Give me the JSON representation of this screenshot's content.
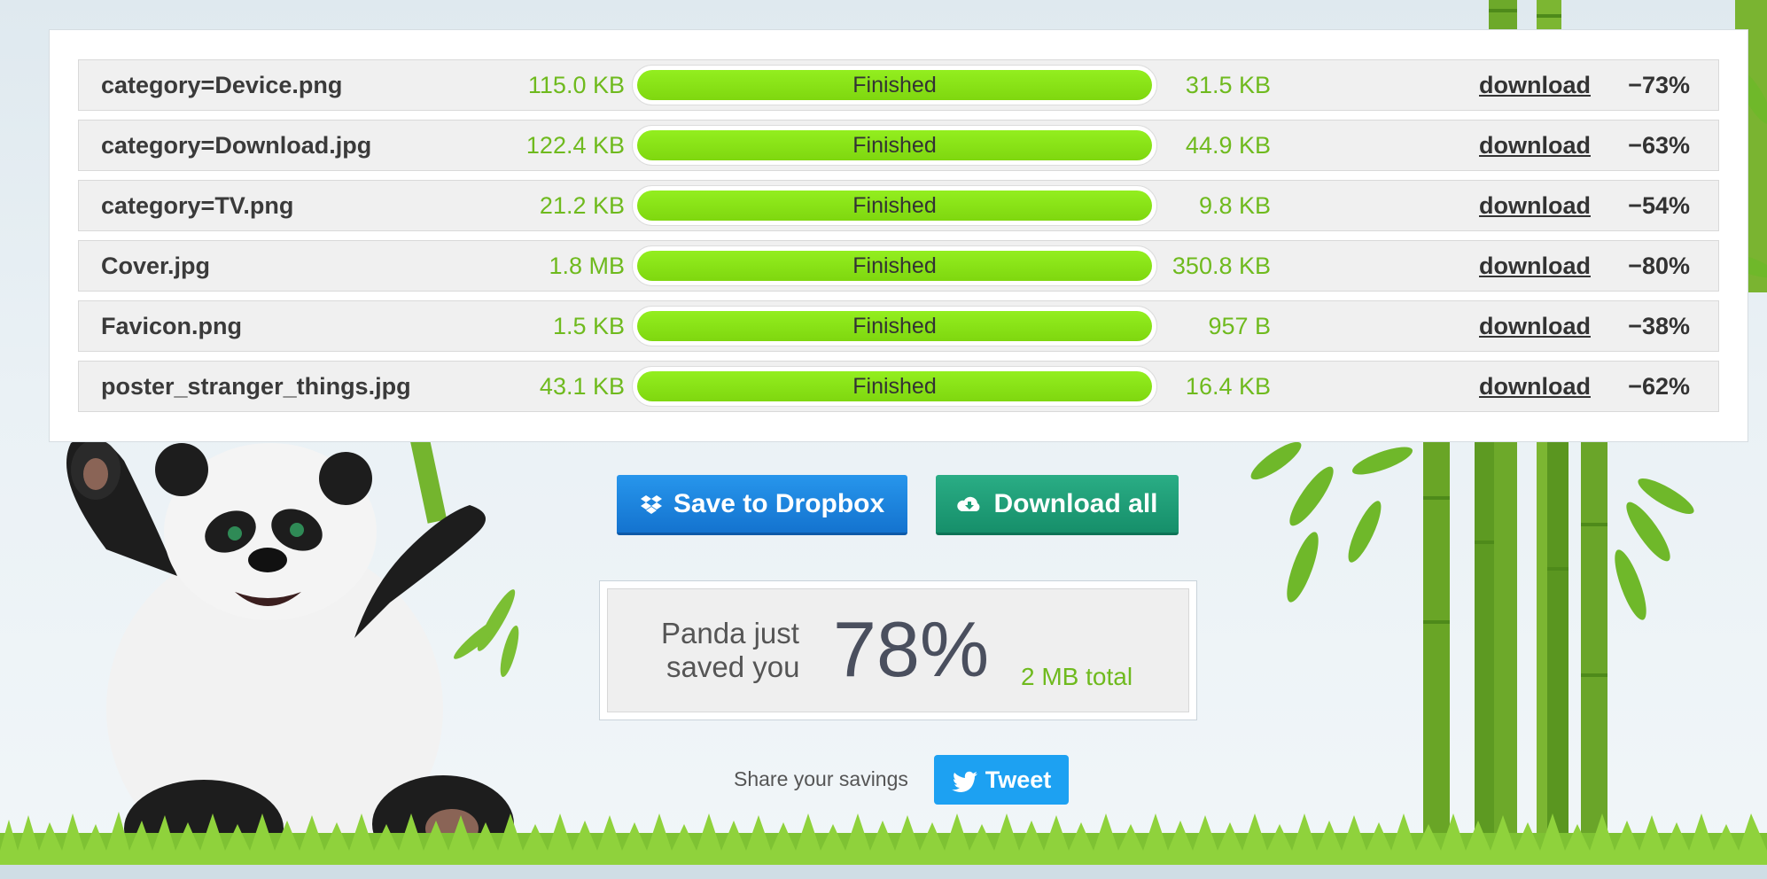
{
  "files": [
    {
      "name": "category=Device.png",
      "original_size": "115.0 KB",
      "status": "Finished",
      "progress": 1.0,
      "new_size": "31.5 KB",
      "action": "download",
      "reduction": "−73%"
    },
    {
      "name": "category=Download.jpg",
      "original_size": "122.4 KB",
      "status": "Finished",
      "progress": 1.0,
      "new_size": "44.9 KB",
      "action": "download",
      "reduction": "−63%"
    },
    {
      "name": "category=TV.png",
      "original_size": "21.2 KB",
      "status": "Finished",
      "progress": 1.0,
      "new_size": "9.8 KB",
      "action": "download",
      "reduction": "−54%"
    },
    {
      "name": "Cover.jpg",
      "original_size": "1.8 MB",
      "status": "Finished",
      "progress": 1.0,
      "new_size": "350.8 KB",
      "action": "download",
      "reduction": "−80%"
    },
    {
      "name": "Favicon.png",
      "original_size": "1.5 KB",
      "status": "Finished",
      "progress": 1.0,
      "new_size": "957 B",
      "action": "download",
      "reduction": "−38%"
    },
    {
      "name": "poster_stranger_things.jpg",
      "original_size": "43.1 KB",
      "status": "Finished",
      "progress": 1.0,
      "new_size": "16.4 KB",
      "action": "download",
      "reduction": "−62%"
    }
  ],
  "actions": {
    "dropbox_label": "Save to Dropbox",
    "download_all_label": "Download all"
  },
  "savings": {
    "line1": "Panda just",
    "line2": "saved you",
    "percent": "78%",
    "total": "2 MB total"
  },
  "share": {
    "label": "Share your savings",
    "tweet_label": "Tweet"
  },
  "icons": {
    "dropbox": "dropbox-icon",
    "download_all": "cloud-download-icon",
    "tweet": "twitter-bird-icon",
    "mascot": "panda-mascot",
    "decor": "bamboo-stalks"
  },
  "colors": {
    "progress_green": "#85dd14",
    "size_green": "#6fba1e",
    "dropbox_blue": "#1f86e0",
    "download_green": "#1e9e78",
    "tweet_blue": "#1da1f2"
  }
}
